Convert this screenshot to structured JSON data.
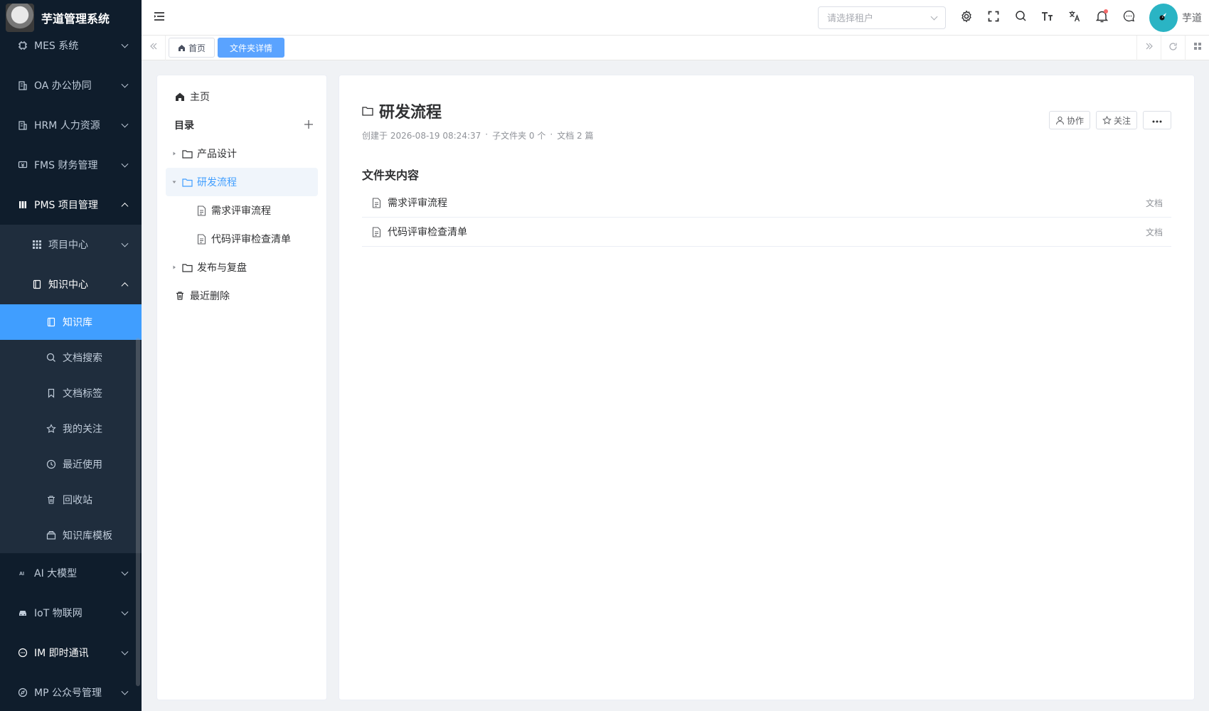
{
  "app": {
    "title": "芋道管理系统"
  },
  "sidebar": {
    "menus": [
      {
        "label": "MES 系统",
        "icon": "chip-icon"
      },
      {
        "label": "OA 办公协同",
        "icon": "building-icon"
      },
      {
        "label": "HRM 人力资源",
        "icon": "building-icon"
      },
      {
        "label": "FMS 财务管理",
        "icon": "finance-icon"
      },
      {
        "label": "PMS 项目管理",
        "icon": "project-icon"
      }
    ],
    "pms_sub": [
      {
        "label": "项目中心",
        "icon": "grid-icon"
      },
      {
        "label": "知识中心",
        "icon": "book-icon"
      }
    ],
    "knowledge_leaves": [
      {
        "label": "知识库",
        "icon": "book-icon"
      },
      {
        "label": "文档搜索",
        "icon": "search-icon"
      },
      {
        "label": "文档标签",
        "icon": "bookmark-icon"
      },
      {
        "label": "我的关注",
        "icon": "star-icon"
      },
      {
        "label": "最近使用",
        "icon": "clock-icon"
      },
      {
        "label": "回收站",
        "icon": "trash-icon"
      },
      {
        "label": "知识库模板",
        "icon": "template-icon"
      }
    ],
    "bottom_menus": [
      {
        "label": "AI 大模型",
        "icon": "ai-icon"
      },
      {
        "label": "IoT 物联网",
        "icon": "iot-icon"
      },
      {
        "label": "IM 即时通讯",
        "icon": "chat-icon"
      },
      {
        "label": "MP 公众号管理",
        "icon": "compass-icon"
      }
    ]
  },
  "header": {
    "tenant_placeholder": "请选择租户",
    "username": "芋道"
  },
  "tags": {
    "home": "首页",
    "current": "文件夹详情"
  },
  "tree": {
    "home": "主页",
    "catalog": "目录",
    "folders": {
      "product": "产品设计",
      "dev": "研发流程",
      "release": "发布与复盘"
    },
    "dev_children": [
      "需求评审流程",
      "代码评审检查清单"
    ],
    "recent_deleted": "最近删除"
  },
  "folder": {
    "title": "研发流程",
    "created": "创建于 2026-08-19 08:24:37",
    "subfolders": "子文件夹 0 个",
    "docs": "文档 2 篇",
    "sep": "·",
    "actions": {
      "collab": "协作",
      "follow": "关注"
    },
    "content_title": "文件夹内容",
    "items": [
      {
        "name": "需求评审流程",
        "type": "文档"
      },
      {
        "name": "代码评审检查清单",
        "type": "文档"
      }
    ]
  },
  "colors": {
    "sidebar_bg": "#0f1d2c",
    "submenu_bg": "#1f2d3d",
    "accent": "#409eff"
  }
}
